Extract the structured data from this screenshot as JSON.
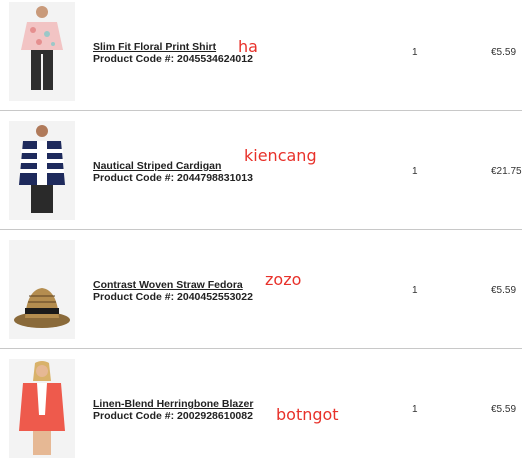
{
  "items": [
    {
      "name": "Slim Fit Floral Print Shirt",
      "code_label": "Product Code #:",
      "code": "2045534624012",
      "qty": "1",
      "price": "€5.59",
      "note": "ha",
      "image_icon": "floral-shirt-icon"
    },
    {
      "name": "Nautical Striped Cardigan",
      "code_label": "Product Code #:",
      "code": "2044798831013",
      "qty": "1",
      "price": "€21.75",
      "note": "kiencang",
      "image_icon": "striped-cardigan-icon"
    },
    {
      "name": "Contrast Woven Straw Fedora",
      "code_label": "Product Code #:",
      "code": "2040452553022",
      "qty": "1",
      "price": "€5.59",
      "note": "zozo",
      "image_icon": "straw-fedora-icon"
    },
    {
      "name": "Linen-Blend Herringbone Blazer",
      "code_label": "Product Code #:",
      "code": "2002928610082",
      "qty": "1",
      "price": "€5.59",
      "note": "botngot",
      "image_icon": "coral-blazer-icon"
    }
  ],
  "colors": {
    "note": "#e8312a",
    "separator": "#c8c8c8"
  }
}
